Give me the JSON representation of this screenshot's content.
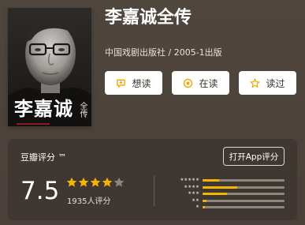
{
  "book": {
    "title": "李嘉诚全传",
    "meta": "中国戏剧出版社 / 2005-1出版",
    "cover": {
      "title_text": "李嘉诚",
      "side_text": "全传"
    }
  },
  "actions": [
    {
      "label": "想读",
      "icon": "want-read-icon"
    },
    {
      "label": "在读",
      "icon": "reading-icon"
    },
    {
      "label": "读过",
      "icon": "read-done-icon"
    }
  ],
  "rating": {
    "label": "豆瓣评分 ™",
    "open_app_label": "打开App评分",
    "score": "7.5",
    "stars_value": 4,
    "stars_max": 5,
    "count_label": "1935人评分",
    "distribution": [
      {
        "stars": 5,
        "fraction": 0.2
      },
      {
        "stars": 4,
        "fraction": 0.42
      },
      {
        "stars": 3,
        "fraction": 0.3
      },
      {
        "stars": 2,
        "fraction": 0.05
      },
      {
        "stars": 1,
        "fraction": 0.03
      }
    ]
  },
  "colors": {
    "background": "#4d433c",
    "card": "#3f3732",
    "accent": "#f5b400",
    "button_bg": "#ffffff"
  }
}
